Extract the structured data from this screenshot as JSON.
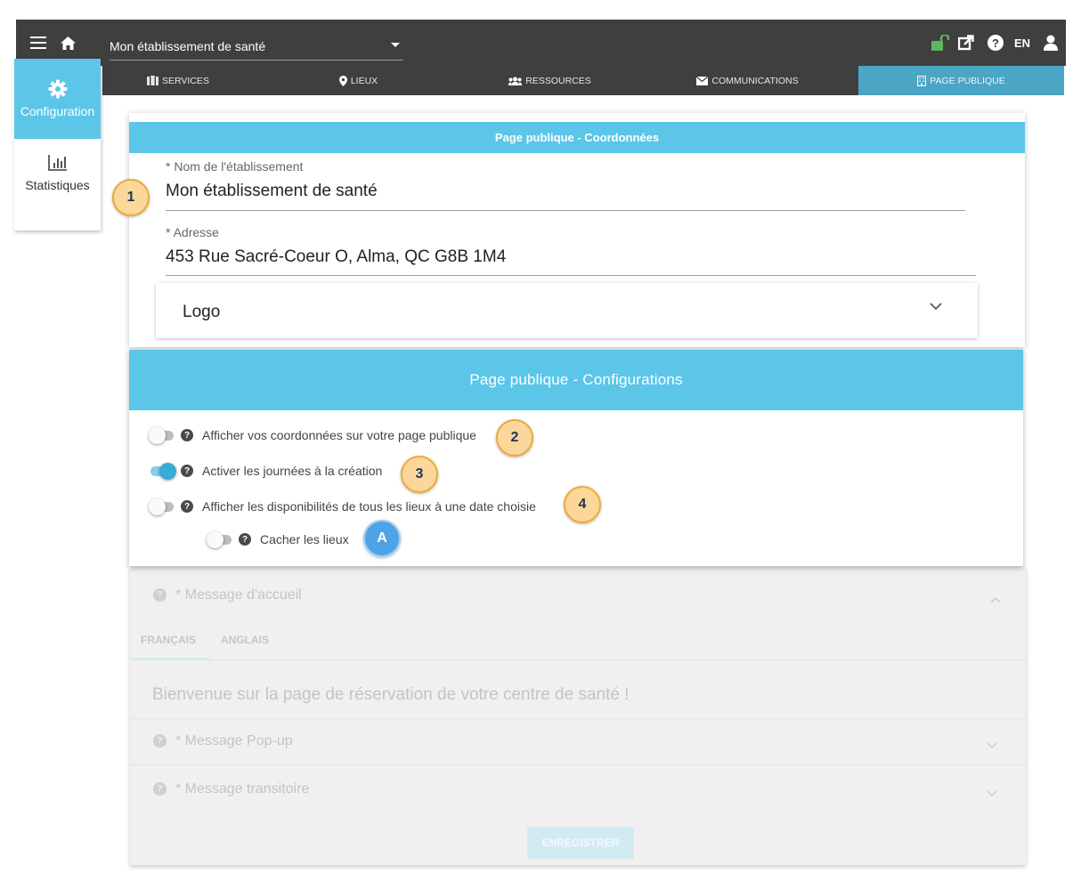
{
  "topbar": {
    "establishment": "Mon établissement de santé",
    "language": "EN",
    "icons": [
      "menu-icon",
      "home-icon",
      "unlock-icon",
      "external-link-icon",
      "help-icon",
      "user-icon"
    ]
  },
  "tabs": [
    {
      "label": "SERVICES",
      "icon": "services-icon",
      "active": false
    },
    {
      "label": "LIEUX",
      "icon": "map-marker-icon",
      "active": false
    },
    {
      "label": "RESSOURCES",
      "icon": "users-icon",
      "active": false
    },
    {
      "label": "COMMUNICATIONS",
      "icon": "envelope-icon",
      "active": false
    },
    {
      "label": "PAGE PUBLIQUE",
      "icon": "building-icon",
      "active": true
    }
  ],
  "sidebar": {
    "items": [
      {
        "label": "Configuration",
        "icon": "gear-icon",
        "active": true
      },
      {
        "label": "Statistiques",
        "icon": "bar-chart-icon",
        "active": false
      }
    ]
  },
  "coordinates_card": {
    "title": "Page publique - Coordonnées",
    "name_label": "* Nom de l'établissement",
    "name_value": "Mon établissement de santé",
    "address_label": "* Adresse",
    "address_value": "453 Rue Sacré-Coeur O, Alma, QC G8B 1M4",
    "logo_label": "Logo"
  },
  "config_card": {
    "title": "Page publique - Configurations",
    "toggles": [
      {
        "label": "Afficher vos coordonnées sur votre page publique",
        "on": false
      },
      {
        "label": "Activer les journées à la création",
        "on": true
      },
      {
        "label": "Afficher les disponibilités de tous les lieux à une date choisie",
        "on": false
      },
      {
        "label": "Cacher les lieux",
        "on": false
      }
    ]
  },
  "callouts": [
    "1",
    "2",
    "3",
    "4",
    "A"
  ],
  "faded_section": {
    "welcome_label": "* Message d'accueil",
    "tab_fr": "FRANÇAIS",
    "tab_en": "ANGLAIS",
    "welcome_text": "Bienvenue sur la page de réservation de votre centre de santé !",
    "popup_label": "* Message Pop-up",
    "transitory_label": "* Message transitoire",
    "save_label": "ENREGISTRER"
  },
  "colors": {
    "accent": "#5bc6e8",
    "topbar": "#3f3f3f",
    "active_tab": "#4aa6c4",
    "unlock": "#5cb85c",
    "callout": "#fcd79b",
    "callout_blue": "#4da3e6"
  }
}
